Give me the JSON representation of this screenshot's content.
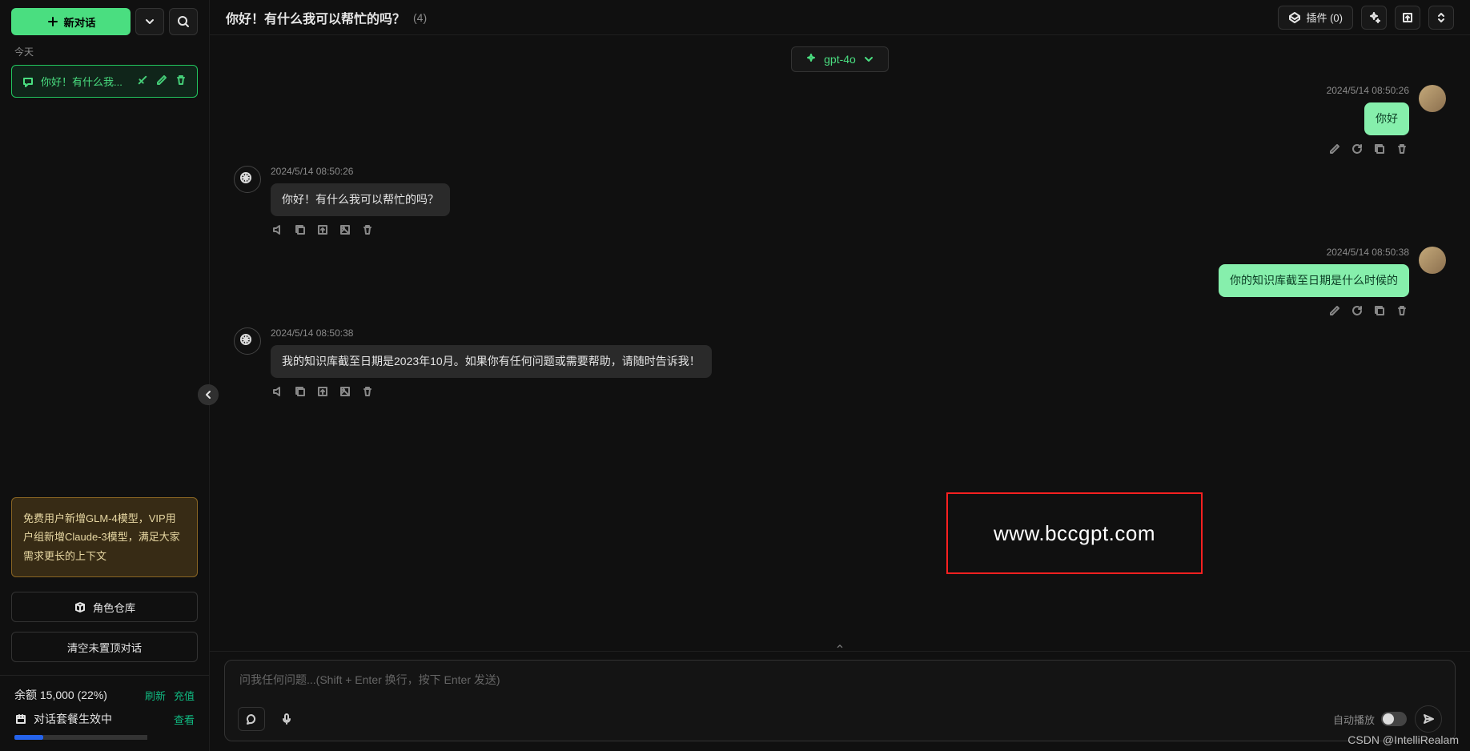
{
  "sidebar": {
    "new_chat": "新对话",
    "today_label": "今天",
    "conversations": [
      {
        "title": "你好！有什么我..."
      }
    ],
    "notice": "免费用户新增GLM-4模型，VIP用户组新增Claude-3模型，满足大家需求更长的上下文",
    "role_store": "角色仓库",
    "clear_unpinned": "清空未置顶对话",
    "balance_label": "余额 15,000 (22%)",
    "refresh": "刷新",
    "recharge": "充值",
    "plan_label": "对话套餐生效中",
    "view": "查看"
  },
  "header": {
    "title": "你好！有什么我可以帮忙的吗？",
    "count": "(4)",
    "plugins_label": "插件 (0)"
  },
  "model": {
    "name": "gpt-4o"
  },
  "messages": [
    {
      "role": "user",
      "time": "2024/5/14 08:50:26",
      "text": "你好"
    },
    {
      "role": "assistant",
      "time": "2024/5/14 08:50:26",
      "text": "你好！有什么我可以帮忙的吗？"
    },
    {
      "role": "user",
      "time": "2024/5/14 08:50:38",
      "text": "你的知识库截至日期是什么时候的"
    },
    {
      "role": "assistant",
      "time": "2024/5/14 08:50:38",
      "text": "我的知识库截至日期是2023年10月。如果你有任何问题或需要帮助，请随时告诉我！"
    }
  ],
  "composer": {
    "placeholder": "问我任何问题...(Shift + Enter 换行，按下 Enter 发送)",
    "auto_play": "自动播放"
  },
  "overlay": {
    "annot": "www.bccgpt.com",
    "watermark": "CSDN @IntelliRealam"
  }
}
